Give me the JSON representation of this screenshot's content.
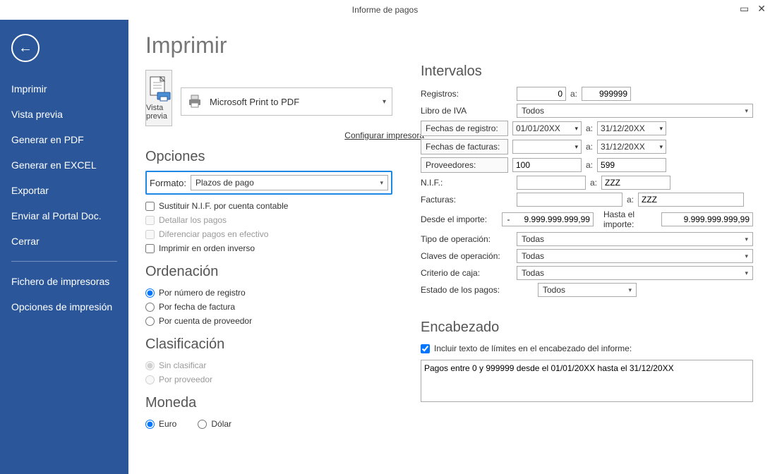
{
  "window": {
    "title": "Informe de pagos"
  },
  "sidebar": {
    "items": [
      "Imprimir",
      "Vista previa",
      "Generar en PDF",
      "Generar en EXCEL",
      "Exportar",
      "Enviar al Portal Doc.",
      "Cerrar"
    ],
    "items2": [
      "Fichero de impresoras",
      "Opciones de impresión"
    ]
  },
  "page": {
    "title": "Imprimir",
    "preview_label": "Vista previa",
    "printer": "Microsoft Print to PDF",
    "config_link": "Configurar impresora"
  },
  "opciones": {
    "title": "Opciones",
    "formato_label": "Formato:",
    "formato_value": "Plazos de pago",
    "checks": {
      "sustituir": "Sustituir N.I.F. por cuenta contable",
      "detallar": "Detallar los pagos",
      "diferenciar": "Diferenciar pagos en efectivo",
      "inverso": "Imprimir en orden inverso"
    }
  },
  "orden": {
    "title": "Ordenación",
    "opts": {
      "registro": "Por número de registro",
      "fecha": "Por fecha de factura",
      "cuenta": "Por cuenta de proveedor"
    }
  },
  "clasif": {
    "title": "Clasificación",
    "opts": {
      "sin": "Sin clasificar",
      "prov": "Por proveedor"
    }
  },
  "moneda": {
    "title": "Moneda",
    "opts": {
      "euro": "Euro",
      "dolar": "Dólar"
    }
  },
  "intervalos": {
    "title": "Intervalos",
    "a": "a:",
    "registros_label": "Registros:",
    "registros_from": "0",
    "registros_to": "999999",
    "libro_label": "Libro de IVA",
    "libro_value": "Todos",
    "fechas_registro_btn": "Fechas de registro:",
    "fechas_registro_from": "01/01/20XX",
    "fechas_registro_to": "31/12/20XX",
    "fechas_facturas_btn": "Fechas de facturas:",
    "fechas_facturas_from": "",
    "fechas_facturas_to": "31/12/20XX",
    "proveedores_btn": "Proveedores:",
    "prov_from": "100",
    "prov_to": "599",
    "nif_label": "N.I.F.:",
    "nif_from": "",
    "nif_to": "ZZZ",
    "facturas_label": "Facturas:",
    "fact_from": "",
    "fact_to": "ZZZ",
    "desde_importe_label": "Desde el importe:",
    "desde_importe": "-      9.999.999.999,99",
    "hasta_importe_label": "Hasta el importe:",
    "hasta_importe": "9.999.999.999,99",
    "tipo_op_label": "Tipo de operación:",
    "tipo_op": "Todas",
    "claves_op_label": "Claves de operación:",
    "claves_op": "Todas",
    "criterio_label": "Criterio de caja:",
    "criterio": "Todas",
    "estado_label": "Estado de los pagos:",
    "estado": "Todos"
  },
  "encabezado": {
    "title": "Encabezado",
    "check": "Incluir texto de límites en el encabezado del informe:",
    "text": "Pagos entre 0 y 999999 desde el 01/01/20XX hasta el 31/12/20XX"
  }
}
